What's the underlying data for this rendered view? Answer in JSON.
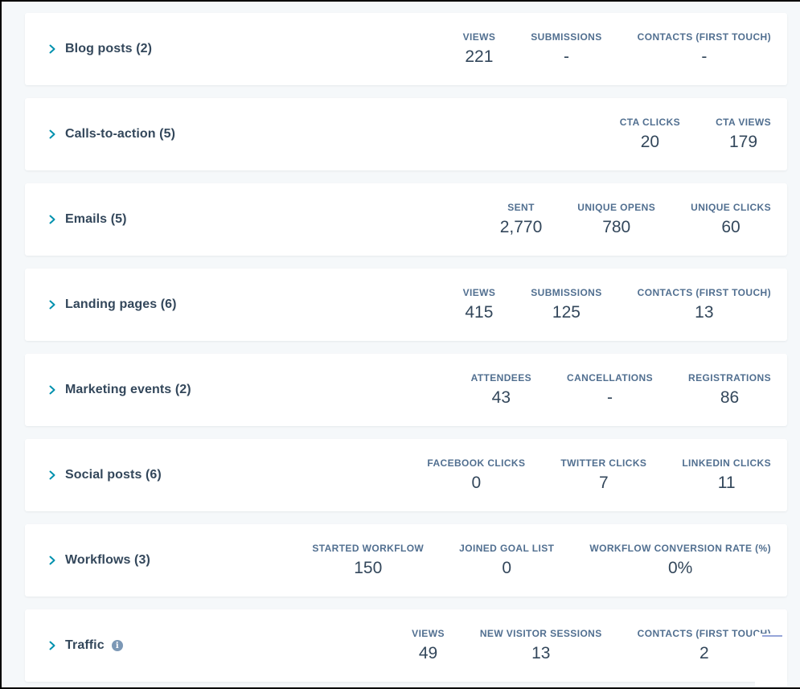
{
  "sections": [
    {
      "title": "Blog posts (2)",
      "has_info": false,
      "metrics": [
        {
          "label": "VIEWS",
          "value": "221"
        },
        {
          "label": "SUBMISSIONS",
          "value": "-"
        },
        {
          "label": "CONTACTS (FIRST TOUCH)",
          "value": "-"
        }
      ]
    },
    {
      "title": "Calls-to-action (5)",
      "has_info": false,
      "metrics": [
        {
          "label": "CTA CLICKS",
          "value": "20"
        },
        {
          "label": "CTA VIEWS",
          "value": "179"
        }
      ]
    },
    {
      "title": "Emails (5)",
      "has_info": false,
      "metrics": [
        {
          "label": "SENT",
          "value": "2,770"
        },
        {
          "label": "UNIQUE OPENS",
          "value": "780"
        },
        {
          "label": "UNIQUE CLICKS",
          "value": "60"
        }
      ]
    },
    {
      "title": "Landing pages (6)",
      "has_info": false,
      "metrics": [
        {
          "label": "VIEWS",
          "value": "415"
        },
        {
          "label": "SUBMISSIONS",
          "value": "125"
        },
        {
          "label": "CONTACTS (FIRST TOUCH)",
          "value": "13"
        }
      ]
    },
    {
      "title": "Marketing events (2)",
      "has_info": false,
      "metrics": [
        {
          "label": "ATTENDEES",
          "value": "43"
        },
        {
          "label": "CANCELLATIONS",
          "value": "-"
        },
        {
          "label": "REGISTRATIONS",
          "value": "86"
        }
      ]
    },
    {
      "title": "Social posts (6)",
      "has_info": false,
      "metrics": [
        {
          "label": "FACEBOOK CLICKS",
          "value": "0"
        },
        {
          "label": "TWITTER CLICKS",
          "value": "7"
        },
        {
          "label": "LINKEDIN CLICKS",
          "value": "11"
        }
      ]
    },
    {
      "title": "Workflows (3)",
      "has_info": false,
      "metrics": [
        {
          "label": "STARTED WORKFLOW",
          "value": "150"
        },
        {
          "label": "JOINED GOAL LIST",
          "value": "0"
        },
        {
          "label": "WORKFLOW CONVERSION RATE (%)",
          "value": "0%"
        }
      ]
    },
    {
      "title": "Traffic",
      "has_info": true,
      "metrics": [
        {
          "label": "VIEWS",
          "value": "49"
        },
        {
          "label": "NEW VISITOR SESSIONS",
          "value": "13"
        },
        {
          "label": "CONTACTS (FIRST TOUCH)",
          "value": "2"
        }
      ]
    }
  ],
  "icons": {
    "expand": "chevron-right-icon",
    "info": "info-icon",
    "info_glyph": "i"
  },
  "colors": {
    "accent": "#0091ae",
    "text": "#33475b",
    "label": "#516f90",
    "background": "#f5f8fa"
  }
}
